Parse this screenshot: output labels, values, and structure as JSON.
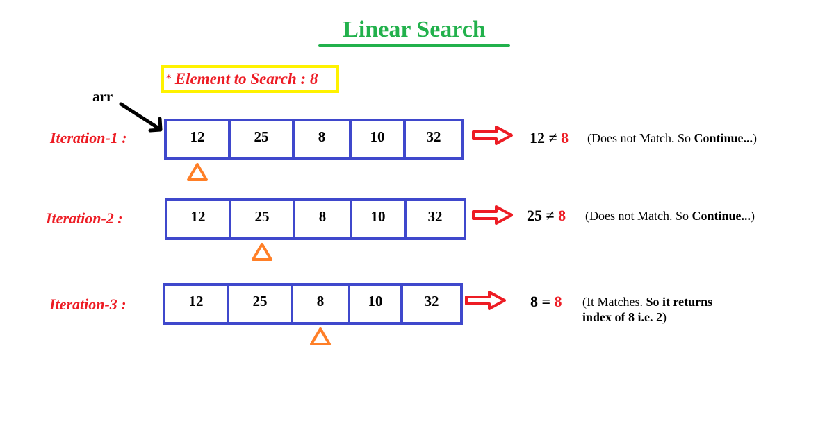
{
  "title": "Linear Search",
  "search_target": {
    "prefix": "*",
    "label": "Element to Search :",
    "value": "8"
  },
  "array_name": "arr",
  "array_values": [
    "12",
    "25",
    "8",
    "10",
    "32"
  ],
  "colors": {
    "title": "#22b14c",
    "highlight_box": "#fff200",
    "label_red": "#ed1c24",
    "array_border": "#3f48cc",
    "pointer": "#ff7f27",
    "arrow": "#ed1c24"
  },
  "iterations": [
    {
      "label": "Iteration-1 :",
      "pointer_index": 0,
      "lhs": "12",
      "operator": "≠",
      "rhs": "8",
      "note_plain": "(Does not Match. So ",
      "note_bold": "Continue...",
      "note_end": ")"
    },
    {
      "label": "Iteration-2 :",
      "pointer_index": 1,
      "lhs": "25",
      "operator": "≠",
      "rhs": "8",
      "note_plain": "(Does not Match. So ",
      "note_bold": "Continue...",
      "note_end": ")"
    },
    {
      "label": "Iteration-3 :",
      "pointer_index": 2,
      "lhs": "8",
      "operator": "=",
      "rhs": "8",
      "note_plain": "(It Matches. ",
      "note_bold": "So it returns",
      "note_line2_bold": "index of  8 i.e. 2",
      "note_end": ")"
    }
  ]
}
